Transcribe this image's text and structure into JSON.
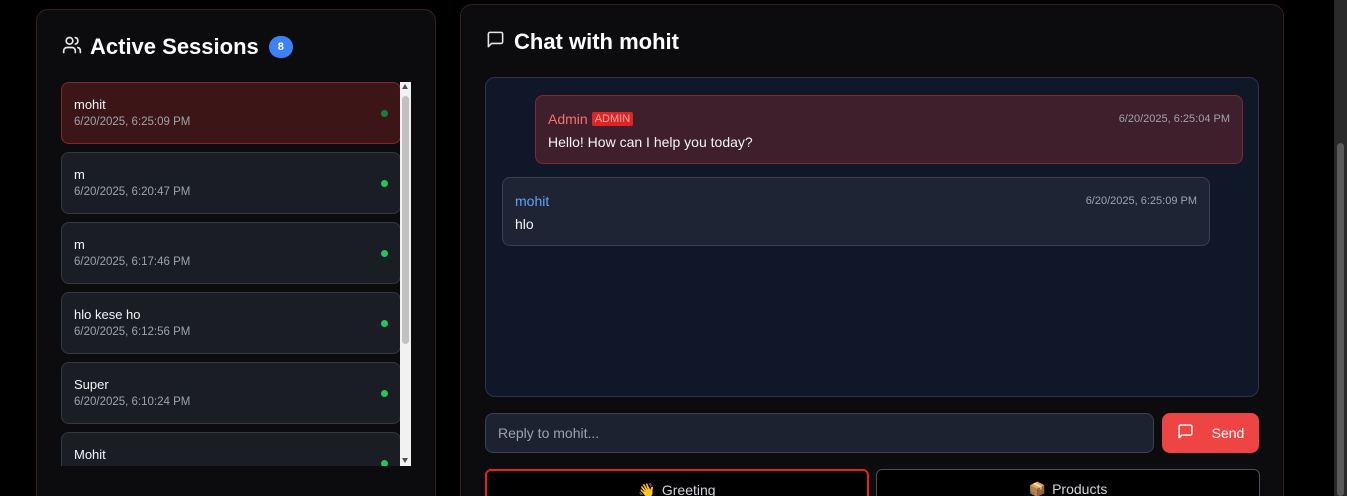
{
  "sessions": {
    "title": "Active Sessions",
    "count": "8",
    "items": [
      {
        "name": "mohit",
        "time": "6/20/2025, 6:25:09 PM"
      },
      {
        "name": "m",
        "time": "6/20/2025, 6:20:47 PM"
      },
      {
        "name": "m",
        "time": "6/20/2025, 6:17:46 PM"
      },
      {
        "name": "hlo kese ho",
        "time": "6/20/2025, 6:12:56 PM"
      },
      {
        "name": "Super",
        "time": "6/20/2025, 6:10:24 PM"
      },
      {
        "name": "Mohit",
        "time": ""
      }
    ]
  },
  "chat": {
    "title": "Chat with mohit",
    "messages": [
      {
        "sender": "Admin",
        "tag": "ADMIN",
        "time": "6/20/2025, 6:25:04 PM",
        "text": "Hello! How can I help you today?"
      },
      {
        "sender": "mohit",
        "time": "6/20/2025, 6:25:09 PM",
        "text": "hlo"
      }
    ],
    "reply_placeholder": "Reply to mohit...",
    "send_label": "Send",
    "quick_replies": [
      {
        "emoji": "👋",
        "label": "Greeting"
      },
      {
        "emoji": "📦",
        "label": "Products"
      }
    ]
  },
  "colors": {
    "accent": "#ef4444",
    "badge": "#3b82f6",
    "online": "#22c55e",
    "user_name": "#60a5fa"
  },
  "icons": {
    "sessions": "users-icon",
    "chat": "message-square-icon",
    "send": "message-square-icon"
  }
}
